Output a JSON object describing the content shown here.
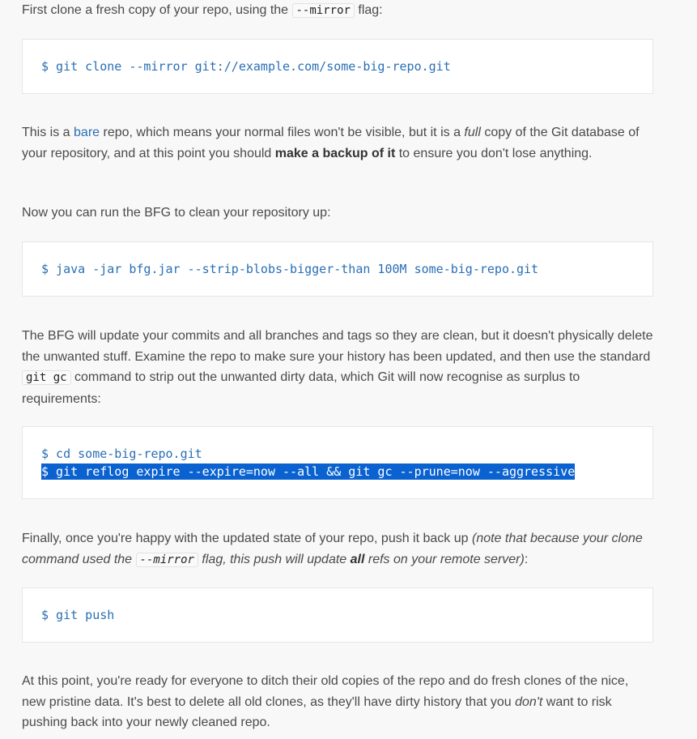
{
  "para1": {
    "before": "First clone a fresh copy of your repo, using the ",
    "code": "--mirror",
    "after": " flag:"
  },
  "code1": {
    "line1": "$ git clone --mirror git://example.com/some-big-repo.git"
  },
  "para2": {
    "t1": "This is a ",
    "link": "bare",
    "t2": " repo, which means your normal files won't be visible, but it is a ",
    "em": "full",
    "t3": " copy of the Git database of your repository, and at this point you should ",
    "strong": "make a backup of it",
    "t4": " to ensure you don't lose anything."
  },
  "para3": {
    "text": "Now you can run the BFG to clean your repository up:"
  },
  "code2": {
    "line1": "$ java -jar bfg.jar --strip-blobs-bigger-than 100M some-big-repo.git"
  },
  "para4": {
    "t1": "The BFG will update your commits and all branches and tags so they are clean, but it doesn't physically delete the unwanted stuff. Examine the repo to make sure your history has been updated, and then use the standard ",
    "code": "git gc",
    "t2": " command to strip out the unwanted dirty data, which Git will now recognise as surplus to requirements:"
  },
  "code3": {
    "line1": "$ cd some-big-repo.git",
    "line2": "$ git reflog expire --expire=now --all && git gc --prune=now --aggressive"
  },
  "para5": {
    "t1": "Finally, once you're happy with the updated state of your repo, push it back up ",
    "em1": "(note that because your clone command used the ",
    "code": "--mirror",
    "em2": " flag, this push will update ",
    "strong": "all",
    "em3": " refs on your remote server)",
    "t2": ":"
  },
  "code4": {
    "line1": "$ git push"
  },
  "para6": {
    "t1": "At this point, you're ready for everyone to ditch their old copies of the repo and do fresh clones of the nice, new pristine data. It's best to delete all old clones, as they'll have dirty history that you ",
    "em": "don't",
    "t2": " want to risk pushing back into your newly cleaned repo."
  }
}
